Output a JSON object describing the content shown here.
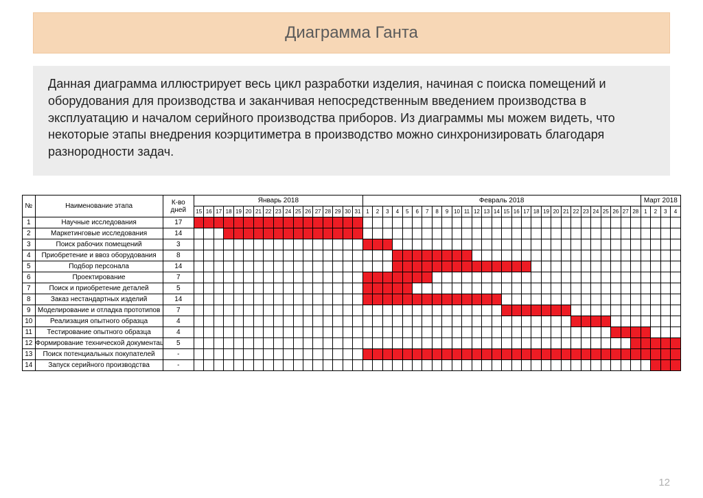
{
  "title": "Диаграмма Ганта",
  "description": "Данная диаграмма иллюстрирует весь цикл разработки изделия, начиная с поиска помещений и оборудования для производства и заканчивая непосредственным введением производства в эксплуатацию и началом серийного производства приборов. Из диаграммы мы можем видеть, что некоторые этапы внедрения коэрцитиметра в производство можно синхронизировать  благодаря разнородности задач.",
  "page_number": "12",
  "headers": {
    "no": "№",
    "name": "Наименование этапа",
    "days": "К-во дней"
  },
  "chart_data": {
    "type": "gantt",
    "title": "Диаграмма Ганта",
    "months": [
      {
        "label": "Январь 2018",
        "days": [
          15,
          16,
          17,
          18,
          19,
          20,
          21,
          22,
          23,
          24,
          25,
          26,
          27,
          28,
          29,
          30,
          31
        ]
      },
      {
        "label": "Февраль 2018",
        "days": [
          1,
          2,
          3,
          4,
          5,
          6,
          7,
          8,
          9,
          10,
          11,
          12,
          13,
          14,
          15,
          16,
          17,
          18,
          19,
          20,
          21,
          22,
          23,
          24,
          25,
          26,
          27,
          28
        ]
      },
      {
        "label": "Март 2018",
        "days": [
          1,
          2,
          3,
          4
        ]
      }
    ],
    "timeline": [
      15,
      16,
      17,
      18,
      19,
      20,
      21,
      22,
      23,
      24,
      25,
      26,
      27,
      28,
      29,
      30,
      31,
      1,
      2,
      3,
      4,
      5,
      6,
      7,
      8,
      9,
      10,
      11,
      12,
      13,
      14,
      15,
      16,
      17,
      18,
      19,
      20,
      21,
      22,
      23,
      24,
      25,
      26,
      27,
      28,
      1,
      2,
      3,
      4
    ],
    "rows": [
      {
        "n": 1,
        "name": "Научные исследования",
        "days": "17",
        "start": 0,
        "len": 17
      },
      {
        "n": 2,
        "name": "Маркетинговые исследования",
        "days": "14",
        "start": 3,
        "len": 14
      },
      {
        "n": 3,
        "name": "Поиск рабочих помещений",
        "days": "3",
        "start": 17,
        "len": 3
      },
      {
        "n": 4,
        "name": "Приобретение и ввоз оборудования",
        "days": "8",
        "start": 20,
        "len": 8
      },
      {
        "n": 5,
        "name": "Подбор персонала",
        "days": "14",
        "start": 20,
        "len": 14
      },
      {
        "n": 6,
        "name": "Проектирование",
        "days": "7",
        "start": 17,
        "len": 7
      },
      {
        "n": 7,
        "name": "Поиск и приобретение деталей",
        "days": "5",
        "start": 17,
        "len": 5
      },
      {
        "n": 8,
        "name": "Заказ нестандартных изделий",
        "days": "14",
        "start": 17,
        "len": 14
      },
      {
        "n": 9,
        "name": "Моделирование и отладка прототипов",
        "days": "7",
        "start": 31,
        "len": 7
      },
      {
        "n": 10,
        "name": "Реализация опытного образца",
        "days": "4",
        "start": 38,
        "len": 4
      },
      {
        "n": 11,
        "name": "Тестирование опытного образца",
        "days": "4",
        "start": 42,
        "len": 4
      },
      {
        "n": 12,
        "name": "Формирование технической документации",
        "days": "5",
        "start": 44,
        "len": 5
      },
      {
        "n": 13,
        "name": "Поиск потенциальных покупателей",
        "days": "-",
        "start": 17,
        "len": 32
      },
      {
        "n": 14,
        "name": "Запуск серийного производства",
        "days": "-",
        "start": 46,
        "len": 3
      }
    ]
  }
}
